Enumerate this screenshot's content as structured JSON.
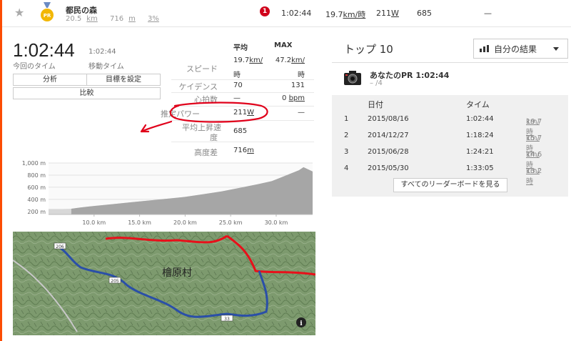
{
  "segment": {
    "name": "都民の森",
    "distance": "20.5",
    "distance_unit": "km",
    "elevation": "716",
    "elevation_unit": "m",
    "grade": "3%",
    "pr_medal_label": "PR",
    "notification_count": "1",
    "time": "1:02:44",
    "speed": "19.7",
    "speed_unit": "km/時",
    "power": "211",
    "power_unit": "W",
    "elevation_gain": "685",
    "hr": "—"
  },
  "summary": {
    "big_time": "1:02:44",
    "big_time_label": "今回のタイム",
    "moving_time": "1:02:44",
    "moving_time_label": "移動タイム"
  },
  "buttons": {
    "analysis": "分析",
    "set_goal": "目標を設定",
    "compare": "比較"
  },
  "stats": {
    "head_avg": "平均",
    "head_max": "MAX",
    "speed_label": "スピード",
    "speed_avg": "19.7",
    "speed_avg_unit1": "km/",
    "speed_avg_unit2": "時",
    "speed_max": "47.2",
    "speed_max_unit1": "km/",
    "speed_max_unit2": "時",
    "cadence_label": "ケイデンス",
    "cadence_avg": "70",
    "cadence_max": "131",
    "hr_label": "心拍数",
    "hr_avg": "—",
    "hr_max": "0",
    "hr_max_unit": "bpm",
    "power_label": "推定パワー",
    "power_avg": "211",
    "power_unit": "W",
    "power_max": "—",
    "vam_label1": "平均上昇速",
    "vam_label2": "度",
    "vam_value": "685",
    "elev_label": "高度差",
    "elev_value": "716",
    "elev_unit": "m"
  },
  "chart_data": {
    "type": "area",
    "title": "",
    "xlabel": "",
    "ylabel": "",
    "x_ticks": [
      "10.0 km",
      "15.0 km",
      "20.0 km",
      "25.0 km",
      "30.0 km"
    ],
    "y_ticks": [
      "1,000 m",
      "800 m",
      "600 m",
      "400 m",
      "200 m"
    ],
    "xlim": [
      5,
      34
    ],
    "ylim": [
      150,
      1000
    ],
    "highlight_range_km": [
      7.5,
      34
    ],
    "series": [
      {
        "x": [
          5.0,
          6.5,
          7.5,
          8.5,
          10.0,
          12.0,
          14.0,
          16.0,
          18.0,
          20.0,
          22.0,
          24.0,
          26.0,
          28.0,
          29.5,
          30.5,
          31.5,
          32.5,
          33.0,
          34.0
        ],
        "y": [
          240,
          240,
          245,
          265,
          290,
          320,
          350,
          380,
          410,
          440,
          485,
          530,
          590,
          650,
          700,
          760,
          820,
          880,
          930,
          860
        ]
      }
    ]
  },
  "map": {
    "place_name": "檜原村",
    "route_markers": [
      "206",
      "205",
      "33"
    ],
    "info_icon": "i"
  },
  "top10": {
    "title": "トップ 10",
    "dropdown_label": "自分の結果",
    "pr_title": "あなたのPR 1:02:44",
    "pr_rank": "– /4",
    "col_date": "日付",
    "col_time": "タイム",
    "rows": [
      {
        "rank": "1",
        "date": "2015/08/16",
        "time": "1:02:44",
        "speed": "19.7",
        "unit": "km/時"
      },
      {
        "rank": "2",
        "date": "2014/12/27",
        "time": "1:18:24",
        "speed": "15.7",
        "unit": "km/時"
      },
      {
        "rank": "3",
        "date": "2015/06/28",
        "time": "1:24:21",
        "speed": "14.6",
        "unit": "km/時"
      },
      {
        "rank": "4",
        "date": "2015/05/30",
        "time": "1:33:05",
        "speed": "13.2",
        "unit": "km/時"
      }
    ],
    "see_all_button": "すべてのリーダーボードを見る"
  },
  "colors": {
    "accent": "#fc4c02",
    "annotation_red": "#e0001a",
    "route_blue": "#2a4fa8",
    "route_red": "#e8101a",
    "map_green": "#7d9a6e"
  }
}
